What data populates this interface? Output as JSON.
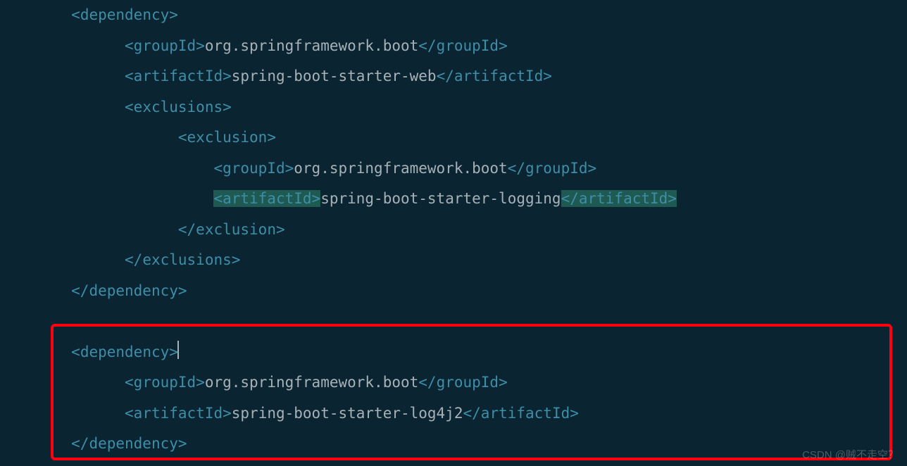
{
  "lines": [
    {
      "indent": "        ",
      "open": "dependency",
      "inner": null,
      "close": null
    },
    {
      "indent": "              ",
      "open": "groupId",
      "inner": "org.springframework.boot",
      "close": "groupId"
    },
    {
      "indent": "              ",
      "open": "artifactId",
      "inner": "spring-boot-starter-web",
      "close": "artifactId"
    },
    {
      "indent": "              ",
      "open": "exclusions",
      "inner": null,
      "close": null
    },
    {
      "indent": "                    ",
      "open": "exclusion",
      "inner": null,
      "close": null
    },
    {
      "indent": "                        ",
      "open": "groupId",
      "inner": "org.springframework.boot",
      "close": "groupId"
    },
    {
      "indent": "                        ",
      "open": "artifactId",
      "inner": "spring-boot-starter-logging",
      "close": "artifactId",
      "highlightTags": true
    },
    {
      "indent": "                    ",
      "closeOnly": "exclusion"
    },
    {
      "indent": "              ",
      "closeOnly": "exclusions"
    },
    {
      "indent": "        ",
      "closeOnly": "dependency"
    },
    {
      "blank": true
    },
    {
      "indent": "        ",
      "open": "dependency",
      "inner": null,
      "close": null,
      "cursor": true
    },
    {
      "indent": "              ",
      "open": "groupId",
      "inner": "org.springframework.boot",
      "close": "groupId"
    },
    {
      "indent": "              ",
      "open": "artifactId",
      "inner": "spring-boot-starter-log4j2",
      "close": "artifactId"
    },
    {
      "indent": "        ",
      "closeOnly": "dependency"
    }
  ],
  "watermark": "CSDN @贼不走空？"
}
